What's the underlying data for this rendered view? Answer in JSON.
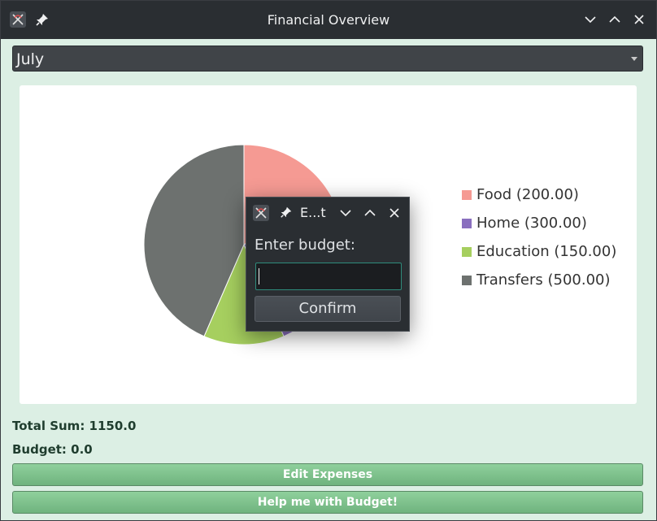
{
  "window": {
    "title": "Financial Overview",
    "pin_symbol": "📌"
  },
  "month_select": {
    "value": "July"
  },
  "chart_data": {
    "type": "pie",
    "categories": [
      "Food",
      "Home",
      "Education",
      "Transfers"
    ],
    "values": [
      200.0,
      300.0,
      150.0,
      500.0
    ],
    "colors": [
      "#f59a93",
      "#8a6fbf",
      "#a6cf5f",
      "#6d716f"
    ],
    "legend": [
      "Food (200.00)",
      "Home (300.00)",
      "Education (150.00)",
      "Transfers (500.00)"
    ],
    "legend_position": "right"
  },
  "summary": {
    "total_sum": "Total Sum: 1150.0",
    "budget": "Budget: 0.0"
  },
  "buttons": {
    "edit_expenses": "Edit Expenses",
    "help_budget": "Help me with Budget!"
  },
  "dialog": {
    "title": "E...t",
    "label": "Enter budget:",
    "input_value": "",
    "confirm": "Confirm"
  }
}
